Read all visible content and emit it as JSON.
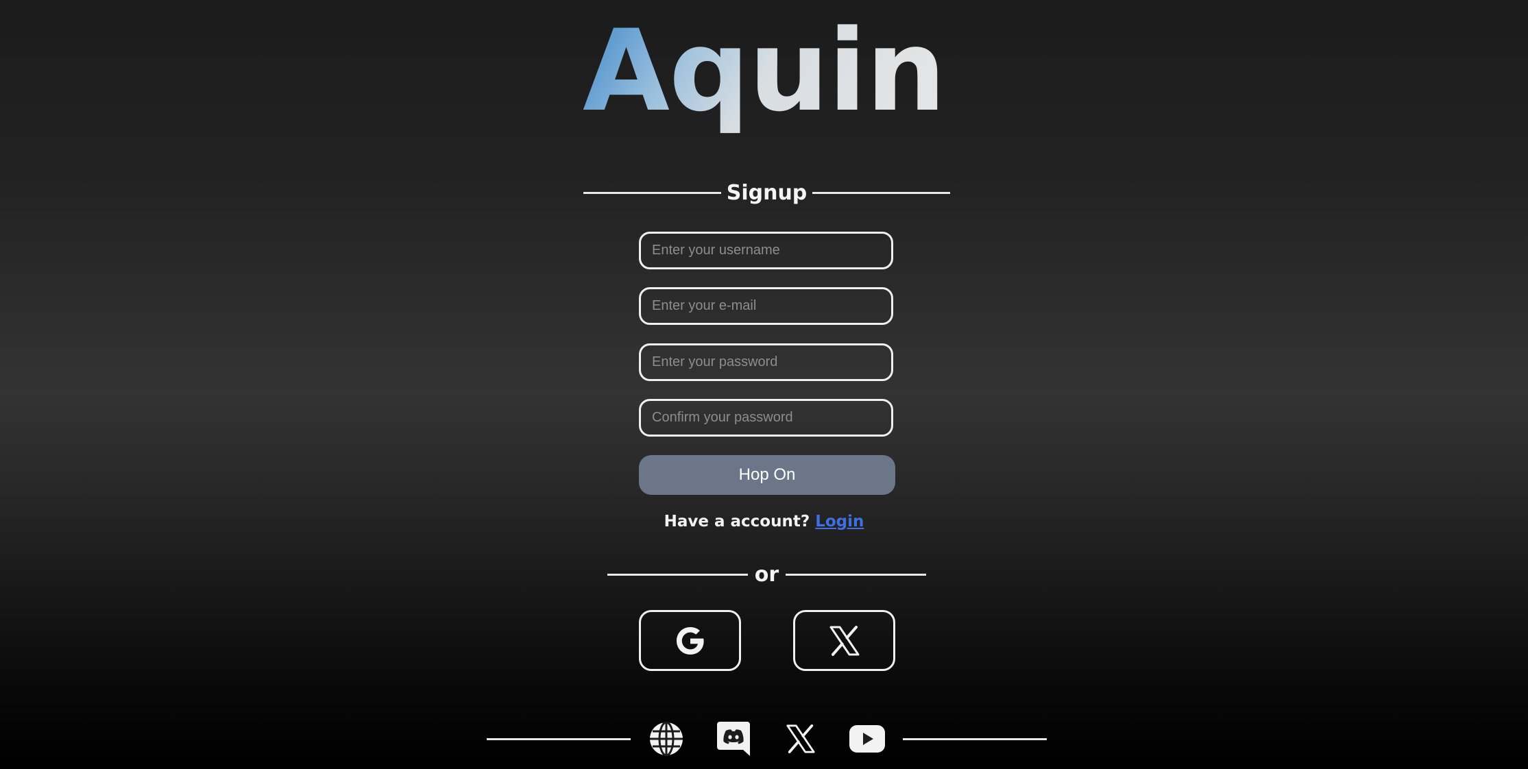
{
  "brand": {
    "logo_text": "Aquin"
  },
  "signup": {
    "title": "Signup",
    "fields": {
      "username_placeholder": "Enter your username",
      "email_placeholder": "Enter your e-mail",
      "password_placeholder": "Enter your password",
      "confirm_password_placeholder": "Confirm your password"
    },
    "submit_label": "Hop On",
    "have_account_text": "Have a account?",
    "login_link_text": "Login"
  },
  "alternate": {
    "or_text": "or",
    "social_buttons": [
      {
        "name": "google",
        "icon": "google-icon"
      },
      {
        "name": "x",
        "icon": "x-icon"
      }
    ]
  },
  "footer": {
    "icons": [
      "globe-icon",
      "discord-icon",
      "x-icon",
      "youtube-icon"
    ]
  },
  "colors": {
    "background_mid": "#333333",
    "button_fill": "#6b7788",
    "link": "#3f6fe0",
    "logo_accent": "#3a86c8",
    "outline": "#f0f0f0"
  }
}
